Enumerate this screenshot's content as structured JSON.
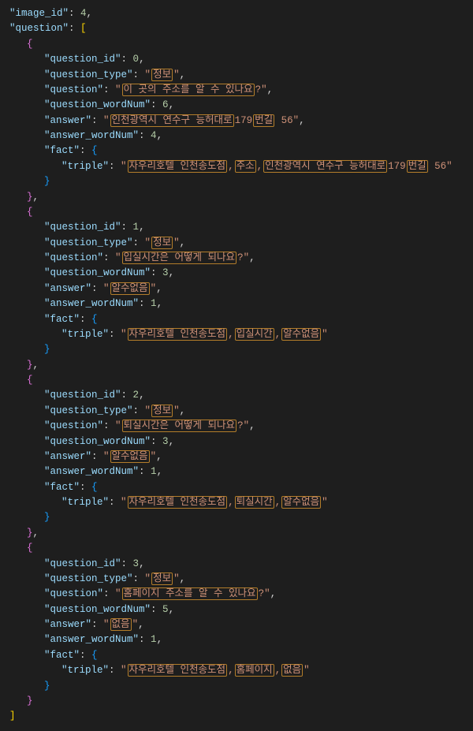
{
  "image_id_key": "\"image_id\"",
  "image_id_val": "4",
  "question_key": "\"question\"",
  "items": [
    {
      "qid_key": "\"question_id\"",
      "qid_val": "0",
      "qtype_key": "\"question_type\"",
      "qtype_pre": "\"",
      "qtype_hl": "정보",
      "qtype_post": "\"",
      "q_key": "\"question\"",
      "q_pre": "\"",
      "q_hl": "이 곳의 주소를 알 수 있나요",
      "q_post": "?\"",
      "qwn_key": "\"question_wordNum\"",
      "qwn_val": "6",
      "ans_key": "\"answer\"",
      "ans_pre": "\"",
      "ans_hl1": "인천광역시 연수구 능허대로",
      "ans_mid": "179",
      "ans_hl2": "번길",
      "ans_post": " 56\"",
      "awn_key": "\"answer_wordNum\"",
      "awn_val": "4",
      "fact_key": "\"fact\"",
      "triple_key": "\"triple\"",
      "t_pre": "\"",
      "t_hl1": "자우리호텔 인천송도점",
      "t_c1": ",",
      "t_hl2": "주소",
      "t_c2": ",",
      "t_hl3": "인천광역시 연수구 능허대로",
      "t_mid": "179",
      "t_hl4": "번길",
      "t_post": " 56\""
    },
    {
      "qid_key": "\"question_id\"",
      "qid_val": "1",
      "qtype_key": "\"question_type\"",
      "qtype_pre": "\"",
      "qtype_hl": "정보",
      "qtype_post": "\"",
      "q_key": "\"question\"",
      "q_pre": "\"",
      "q_hl": "입실시간은 어떻게 되나요",
      "q_post": "?\"",
      "qwn_key": "\"question_wordNum\"",
      "qwn_val": "3",
      "ans_key": "\"answer\"",
      "ans_pre": "\"",
      "ans_hl1": "알수없음",
      "ans_mid": "",
      "ans_hl2": "",
      "ans_post": "\"",
      "awn_key": "\"answer_wordNum\"",
      "awn_val": "1",
      "fact_key": "\"fact\"",
      "triple_key": "\"triple\"",
      "t_pre": "\"",
      "t_hl1": "자우리호텔 인천송도점",
      "t_c1": ",",
      "t_hl2": "입실시간",
      "t_c2": ",",
      "t_hl3": "알수없음",
      "t_mid": "",
      "t_hl4": "",
      "t_post": "\""
    },
    {
      "qid_key": "\"question_id\"",
      "qid_val": "2",
      "qtype_key": "\"question_type\"",
      "qtype_pre": "\"",
      "qtype_hl": "정보",
      "qtype_post": "\"",
      "q_key": "\"question\"",
      "q_pre": "\"",
      "q_hl": "퇴실시간은 어떻게 되나요",
      "q_post": "?\"",
      "qwn_key": "\"question_wordNum\"",
      "qwn_val": "3",
      "ans_key": "\"answer\"",
      "ans_pre": "\"",
      "ans_hl1": "알수없음",
      "ans_mid": "",
      "ans_hl2": "",
      "ans_post": "\"",
      "awn_key": "\"answer_wordNum\"",
      "awn_val": "1",
      "fact_key": "\"fact\"",
      "triple_key": "\"triple\"",
      "t_pre": "\"",
      "t_hl1": "자우리호텔 인천송도점",
      "t_c1": ",",
      "t_hl2": "퇴실시간",
      "t_c2": ",",
      "t_hl3": "알수없음",
      "t_mid": "",
      "t_hl4": "",
      "t_post": "\""
    },
    {
      "qid_key": "\"question_id\"",
      "qid_val": "3",
      "qtype_key": "\"question_type\"",
      "qtype_pre": "\"",
      "qtype_hl": "정보",
      "qtype_post": "\"",
      "q_key": "\"question\"",
      "q_pre": "\"",
      "q_hl": "홈페이지 주소를 알 수 있나요",
      "q_post": "?\"",
      "qwn_key": "\"question_wordNum\"",
      "qwn_val": "5",
      "ans_key": "\"answer\"",
      "ans_pre": "\"",
      "ans_hl1": "없음",
      "ans_mid": "",
      "ans_hl2": "",
      "ans_post": "\"",
      "awn_key": "\"answer_wordNum\"",
      "awn_val": "1",
      "fact_key": "\"fact\"",
      "triple_key": "\"triple\"",
      "t_pre": "\"",
      "t_hl1": "자우리호텔 인천송도점",
      "t_c1": ",",
      "t_hl2": "홈페이지",
      "t_c2": ",",
      "t_hl3": "없음",
      "t_mid": "",
      "t_hl4": "",
      "t_post": "\""
    }
  ]
}
